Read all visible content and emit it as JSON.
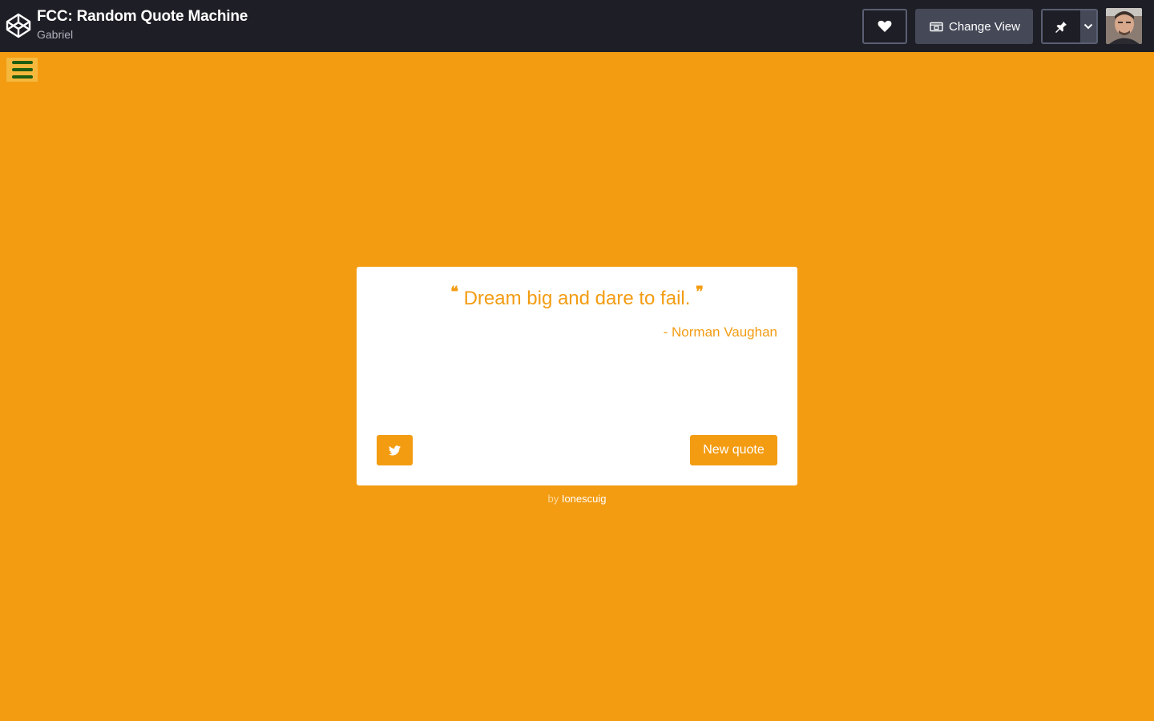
{
  "header": {
    "title": "FCC: Random Quote Machine",
    "author": "Gabriel",
    "change_view_label": "Change View",
    "icons": {
      "logo": "codepen-logo-icon",
      "heart": "heart-icon",
      "view": "change-view-icon",
      "pin": "pin-icon",
      "caret": "chevron-down-icon"
    }
  },
  "app": {
    "menu_icon": "hamburger-icon",
    "accent_color": "#f39c12",
    "quote": {
      "open_mark": "❝",
      "text": "Dream big and dare to fail.",
      "close_mark": "❞",
      "author": "- Norman Vaughan"
    },
    "tweet_icon": "twitter-icon",
    "new_quote_label": "New quote",
    "credit": {
      "by": "by",
      "name": "Ionescuig"
    }
  }
}
